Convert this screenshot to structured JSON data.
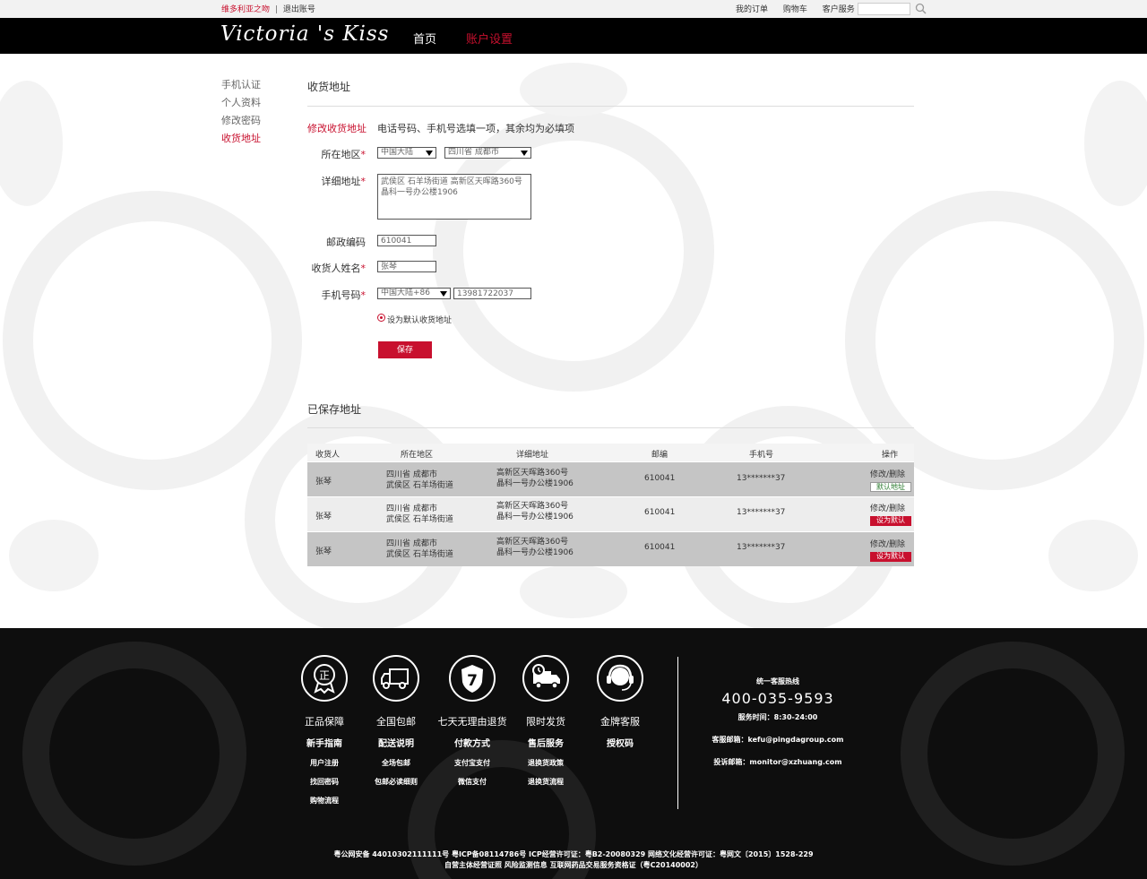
{
  "topbar": {
    "brand_link": "维多利亚之吻",
    "separator": "|",
    "logout": "退出账号",
    "my_orders": "我的订单",
    "cart": "购物车",
    "service": "客户服务"
  },
  "header": {
    "logo": "Victoria 's Kiss",
    "nav_home": "首页",
    "nav_account": "账户设置"
  },
  "sidebar": {
    "items": [
      {
        "label": "手机认证"
      },
      {
        "label": "个人资料"
      },
      {
        "label": "修改密码"
      },
      {
        "label": "收货地址"
      }
    ]
  },
  "address_form": {
    "section_title": "收货地址",
    "edit_label": "修改收货地址",
    "hint": "电话号码、手机号选填一项，其余均为必填项",
    "region_label": "所在地区",
    "country_value": "中国大陆",
    "province_value": "四川省 成都市",
    "detail_label": "详细地址",
    "detail_value": "武侯区 石羊场街道  高新区天晖路360号 晶科一号办公楼1906",
    "zip_label": "邮政编码",
    "zip_value": "610041",
    "name_label": "收货人姓名",
    "name_value": "张琴",
    "phone_label": "手机号码",
    "phone_code_value": "中国大陆+86",
    "phone_value": "13981722037",
    "default_checkbox": "设为默认收货地址",
    "save_button": "保存",
    "required_mark": "*"
  },
  "saved": {
    "section_title": "已保存地址",
    "headers": [
      "收货人",
      "所在地区",
      "详细地址",
      "邮编",
      "手机号",
      "操作"
    ],
    "rows": [
      {
        "name": "张琴",
        "region1": "四川省 成都市",
        "region2": "武侯区 石羊场街道",
        "addr1": "高新区天晖路360号",
        "addr2": "晶科一号办公楼1906",
        "zip": "610041",
        "phone": "13*******37",
        "action": "修改/删除",
        "badge": "默认地址"
      },
      {
        "name": "张琴",
        "region1": "四川省 成都市",
        "region2": "武侯区 石羊场街道",
        "addr1": "高新区天晖路360号",
        "addr2": "晶科一号办公楼1906",
        "zip": "610041",
        "phone": "13*******37",
        "action": "修改/删除",
        "badge": "设为默认"
      },
      {
        "name": "张琴",
        "region1": "四川省 成都市",
        "region2": "武侯区 石羊场街道",
        "addr1": "高新区天晖路360号",
        "addr2": "晶科一号办公楼1906",
        "zip": "610041",
        "phone": "13*******37",
        "action": "修改/删除",
        "badge": "设为默认"
      }
    ]
  },
  "footer": {
    "columns": [
      {
        "icon": "genuine-seal-icon",
        "title": "正品保障",
        "sub": "新手指南",
        "links": [
          "用户注册",
          "找回密码",
          "购物流程"
        ]
      },
      {
        "icon": "delivery-truck-icon",
        "title": "全国包邮",
        "sub": "配送说明",
        "links": [
          "全场包邮",
          "包邮必读细则"
        ]
      },
      {
        "icon": "seven-day-return-icon",
        "title": "七天无理由退货",
        "sub": "付款方式",
        "links": [
          "支付宝支付",
          "微信支付"
        ]
      },
      {
        "icon": "fast-shipping-icon",
        "title": "限时发货",
        "sub": "售后服务",
        "links": [
          "退换货政策",
          "退换货流程"
        ]
      },
      {
        "icon": "headset-icon",
        "title": "金牌客服",
        "sub": "授权码",
        "links": []
      }
    ],
    "shield_number": "7",
    "seal_char": "正",
    "hotline_title": "统一客服热线",
    "hotline_number": "400-035-9593",
    "hours": "服务时间：8:30-24:00",
    "service_email": "客服邮箱：kefu@pingdagroup.com",
    "complaint_email": "投诉邮箱：monitor@xzhuang.com",
    "legal_line1": "粤公网安备 44010302111111号  粤ICP备08114786号 ICP经营许可证：粤B2-20080329 网络文化经营许可证：粤网文〔2015〕1528-229",
    "legal_line2": "自营主体经营证照  风险监测信息  互联网药品交易服务资格证（粤C20140002）"
  },
  "colors": {
    "accent": "#c8102e",
    "header_bg": "#000000",
    "footer_bg": "#0e0e0e",
    "row_dark": "#c5c5c5",
    "row_light": "#ededed",
    "default_badge_text": "#2e7d32"
  }
}
